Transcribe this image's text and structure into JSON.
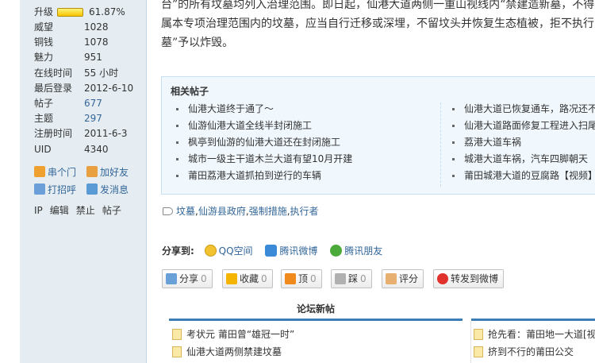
{
  "sidebar": {
    "level": {
      "label": "升级",
      "progress_percent": 61.87,
      "value": "61.87%"
    },
    "stats": [
      {
        "label": "威望",
        "value": "1028",
        "link": false
      },
      {
        "label": "铜钱",
        "value": "1078",
        "link": false
      },
      {
        "label": "魅力",
        "value": "951",
        "link": false
      },
      {
        "label": "在线时间",
        "value": "55 小时",
        "link": false
      },
      {
        "label": "最后登录",
        "value": "2012-6-10",
        "link": false
      },
      {
        "label": "帖子",
        "value": "677",
        "link": true
      },
      {
        "label": "主题",
        "value": "297",
        "link": true
      },
      {
        "label": "注册时间",
        "value": "2011-6-3",
        "link": false
      },
      {
        "label": "UID",
        "value": "4340",
        "link": false
      }
    ],
    "actions": {
      "visit": "串个门",
      "add_friend": "加好友",
      "greet": "打招呼",
      "message": "发消息"
    },
    "admin": [
      "IP",
      "编辑",
      "禁止",
      "帖子"
    ]
  },
  "post": {
    "lines": [
      "台”的所有坟墓均列入治理范围。即日起，仙港大道两侧一重山视线内“禁建造新墓，不得",
      "属本专项治理范围内的坟墓，应当自行迁移或深埋，不留坟头并恢复生态植被，拒不执行",
      "墓”予以炸毁。"
    ]
  },
  "related": {
    "title": "相关帖子",
    "left": [
      "仙港大道终于通了～",
      "仙游仙港大道全线半封闭施工",
      "枫亭到仙游的仙港大道还在封闭施工",
      "城市一级主干道木兰大道有望10月开建",
      "莆田荔港大道抓拍到逆行的车辆"
    ],
    "right": [
      "仙港大道已恢复通车，路况还不错",
      "仙港大道路面修复工程进入扫尾",
      "荔港大道车祸",
      "城港大道车祸，汽车四脚朝天",
      "莆田城港大道的豆腐路【视频】"
    ]
  },
  "tags": [
    "坟墓",
    "仙游县政府",
    "强制措施",
    "执行者"
  ],
  "tag_separator": ",",
  "share": {
    "label": "分享到:",
    "items": [
      "QQ空间",
      "腾讯微博",
      "腾讯朋友"
    ]
  },
  "buttons": {
    "share": {
      "label": "分享",
      "count": "0"
    },
    "favorite": {
      "label": "收藏",
      "count": "0"
    },
    "up": {
      "label": "顶",
      "count": "0"
    },
    "down": {
      "label": "踩",
      "count": "0"
    },
    "rate": {
      "label": "评分"
    },
    "weibo": {
      "label": "转发到微博"
    }
  },
  "new_posts": {
    "title": "论坛新帖",
    "left": [
      "考状元 莆田曾“雄冠一时”",
      "仙港大道两侧禁建坟墓"
    ],
    "right": [
      "抢先看：莆田地一大道[视",
      "挤到不行的莆田公交"
    ]
  },
  "colors": {
    "sidebar_bg": "#e5edf2",
    "link": "#336699",
    "related_bg": "#f0f7fd",
    "bar_blue": "#3e7cb5"
  }
}
